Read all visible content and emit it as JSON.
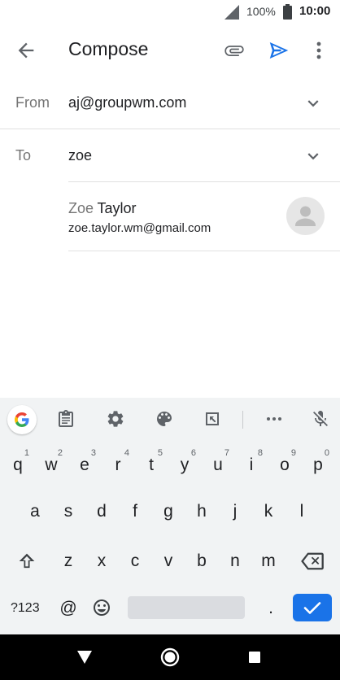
{
  "status_bar": {
    "battery_percent": "100%",
    "time": "10:00",
    "icons": [
      "signal-icon",
      "battery-icon"
    ]
  },
  "app_bar": {
    "title": "Compose",
    "icons": [
      "back-arrow-icon",
      "attach-icon",
      "send-icon",
      "more-vert-icon"
    ]
  },
  "compose": {
    "from_label": "From",
    "from_value": "aj@groupwm.com",
    "to_label": "To",
    "to_value": "zoe"
  },
  "suggestion": {
    "first_name": "Zoe",
    "last_name": "Taylor",
    "email": "zoe.taylor.wm@gmail.com"
  },
  "keyboard": {
    "toolbar_icons": [
      "google-icon",
      "clipboard-icon",
      "settings-icon",
      "palette-icon",
      "resize-icon",
      "more-horiz-icon",
      "mic-off-icon"
    ],
    "row1": [
      {
        "k": "q",
        "h": "1"
      },
      {
        "k": "w",
        "h": "2"
      },
      {
        "k": "e",
        "h": "3"
      },
      {
        "k": "r",
        "h": "4"
      },
      {
        "k": "t",
        "h": "5"
      },
      {
        "k": "y",
        "h": "6"
      },
      {
        "k": "u",
        "h": "7"
      },
      {
        "k": "i",
        "h": "8"
      },
      {
        "k": "o",
        "h": "9"
      },
      {
        "k": "p",
        "h": "0"
      }
    ],
    "row2": [
      "a",
      "s",
      "d",
      "f",
      "g",
      "h",
      "j",
      "k",
      "l"
    ],
    "row3": [
      "z",
      "x",
      "c",
      "v",
      "b",
      "n",
      "m"
    ],
    "symbols_label": "?123",
    "at_label": "@",
    "period_label": ".",
    "accent_color": "#1a73e8"
  },
  "nav_bar": {
    "icons": [
      "nav-back-icon",
      "nav-home-icon",
      "nav-recents-icon"
    ]
  }
}
